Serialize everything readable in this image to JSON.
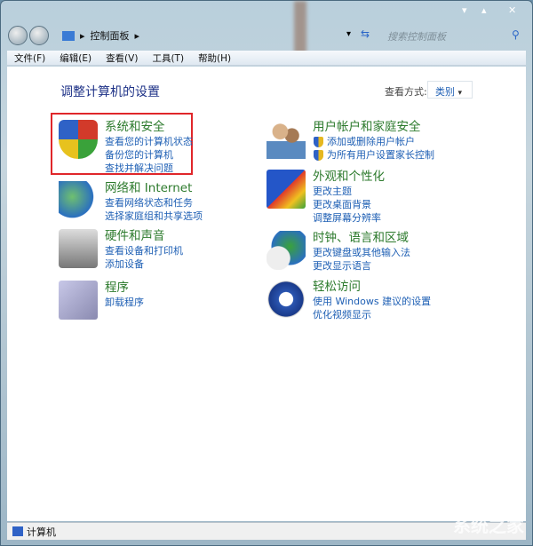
{
  "window": {
    "controls": [
      "▾",
      "▴",
      "✕"
    ]
  },
  "address": {
    "path": [
      "控制面板"
    ],
    "search_placeholder": "搜索控制面板"
  },
  "menu": [
    "文件(F)",
    "编辑(E)",
    "查看(V)",
    "工具(T)",
    "帮助(H)"
  ],
  "page_title": "调整计算机的设置",
  "view": {
    "label": "查看方式:",
    "value": "类别"
  },
  "categories": [
    {
      "title": "系统和安全",
      "links": [
        "查看您的计算机状态",
        "备份您的计算机",
        "查找并解决问题"
      ]
    },
    {
      "title": "网络和 Internet",
      "links": [
        "查看网络状态和任务",
        "选择家庭组和共享选项"
      ]
    },
    {
      "title": "硬件和声音",
      "links": [
        "查看设备和打印机",
        "添加设备"
      ]
    },
    {
      "title": "程序",
      "links": [
        "卸载程序"
      ]
    },
    {
      "title": "用户帐户和家庭安全",
      "links": [
        "添加或删除用户帐户",
        "为所有用户设置家长控制"
      ]
    },
    {
      "title": "外观和个性化",
      "links": [
        "更改主题",
        "更改桌面背景",
        "调整屏幕分辨率"
      ]
    },
    {
      "title": "时钟、语言和区域",
      "links": [
        "更改键盘或其他输入法",
        "更改显示语言"
      ]
    },
    {
      "title": "轻松访问",
      "links": [
        "使用 Windows 建议的设置",
        "优化视频显示"
      ]
    }
  ],
  "status": {
    "text": "计算机"
  },
  "watermark": "系统之家"
}
